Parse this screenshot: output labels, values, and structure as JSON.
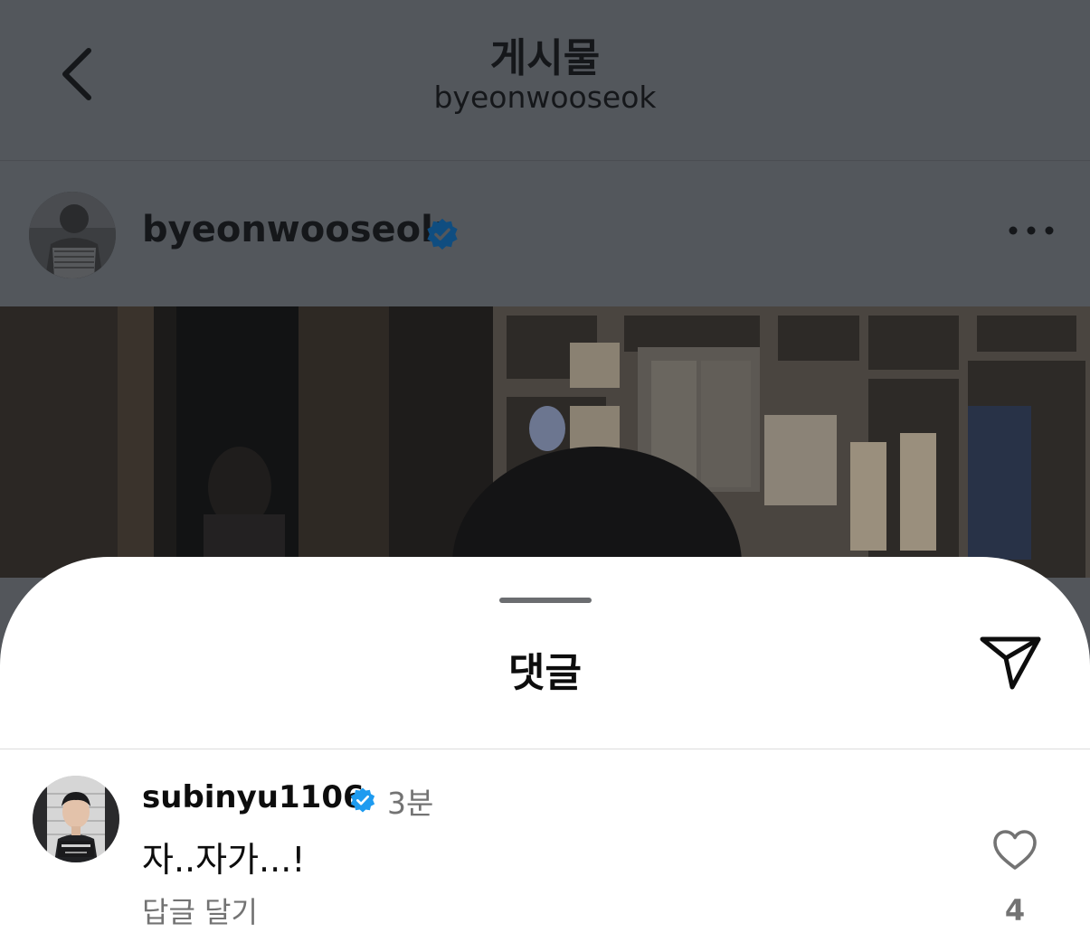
{
  "nav": {
    "title": "게시물",
    "subtitle": "byeonwooseok"
  },
  "post": {
    "username": "byeonwooseok",
    "verified": true
  },
  "comments_sheet": {
    "title": "댓글",
    "comments": [
      {
        "username": "subinyu1106",
        "verified": true,
        "time": "3분",
        "text": "자..자가...!",
        "reply_label": "답글 달기",
        "like_count": "4"
      }
    ]
  },
  "colors": {
    "overlay": "#53575c",
    "verified_blue": "#1d9bf0",
    "verified_dimmed": "#0f4d80",
    "secondary_text": "#737373"
  }
}
